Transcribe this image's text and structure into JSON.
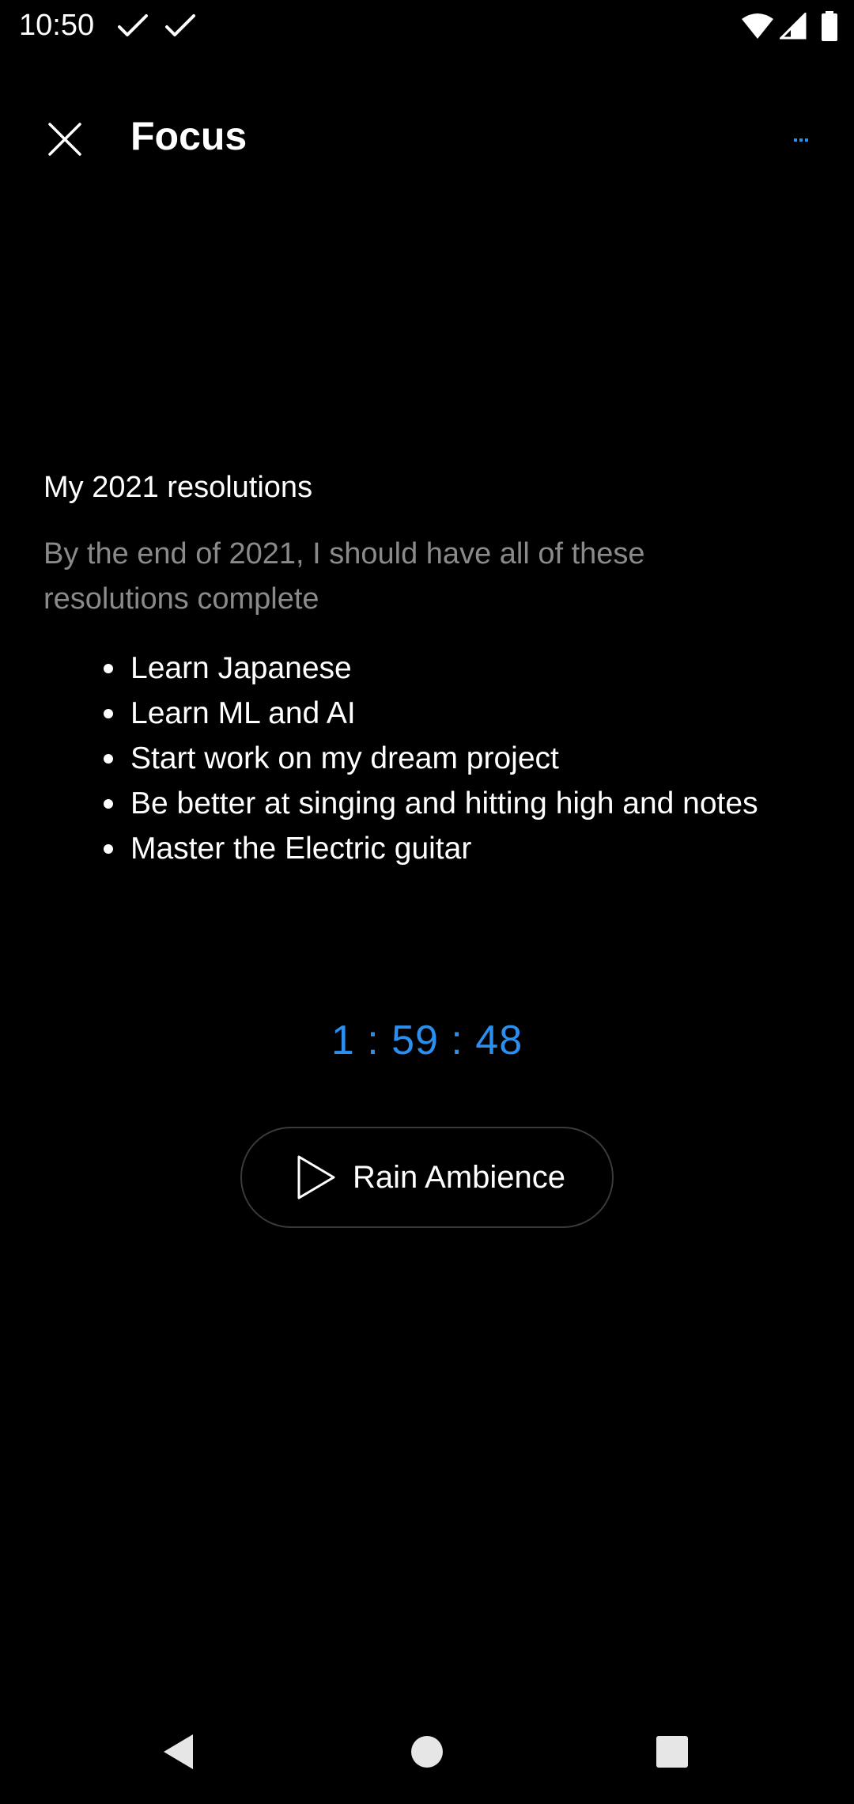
{
  "status_bar": {
    "time": "10:50",
    "icons": [
      "check-icon",
      "check-icon",
      "wifi-icon",
      "cell-signal-icon",
      "battery-icon"
    ]
  },
  "app_bar": {
    "title": "Focus",
    "close_icon": "close-icon",
    "more_label": "...",
    "more_color": "#2b8ff0"
  },
  "note": {
    "title": "My 2021 resolutions",
    "description": "By the end of 2021, I should have all of these resolutions complete",
    "items": [
      "Learn Japanese",
      "Learn ML and AI",
      "Start work on my dream project",
      "Be better at singing and hitting high and notes",
      "Master the Electric guitar"
    ]
  },
  "timer": {
    "display": "1 : 59 : 48",
    "color": "#2b8ff0"
  },
  "ambience": {
    "label": "Rain Ambience",
    "icon": "play-icon"
  },
  "nav_bar": {
    "icons": [
      "back-icon",
      "home-icon",
      "recents-icon"
    ]
  }
}
